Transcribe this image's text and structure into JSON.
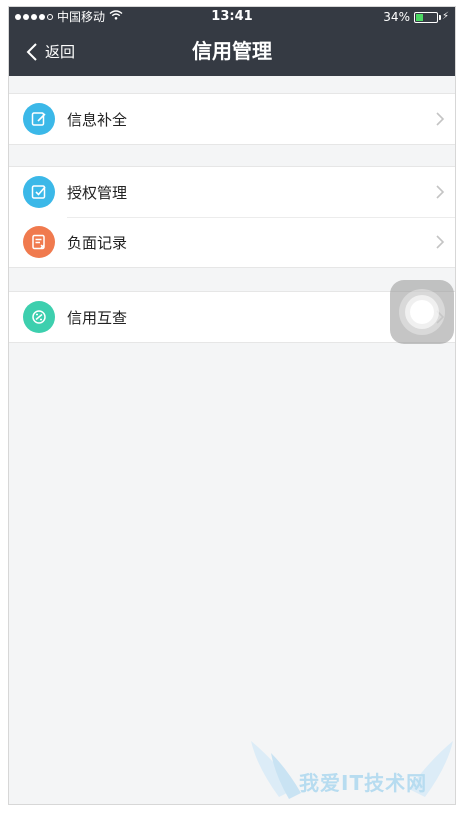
{
  "status_bar": {
    "carrier": "中国移动",
    "time": "13:41",
    "battery": "34%",
    "battery_level": 0.34
  },
  "nav": {
    "back_label": "返回",
    "title": "信用管理"
  },
  "groups": [
    {
      "items": [
        {
          "label": "信息补全",
          "icon": "edit-icon",
          "color": "#3bb8e8"
        }
      ]
    },
    {
      "items": [
        {
          "label": "授权管理",
          "icon": "checkbox-icon",
          "color": "#3bb8e8"
        },
        {
          "label": "负面记录",
          "icon": "record-icon",
          "color": "#f07a4e"
        }
      ]
    },
    {
      "items": [
        {
          "label": "信用互查",
          "icon": "exchange-icon",
          "color": "#3dcfae"
        }
      ]
    }
  ],
  "watermark": {
    "text": "我爱IT技术网"
  },
  "colors": {
    "nav_bg": "#353a43",
    "page_bg": "#f4f5f6"
  }
}
